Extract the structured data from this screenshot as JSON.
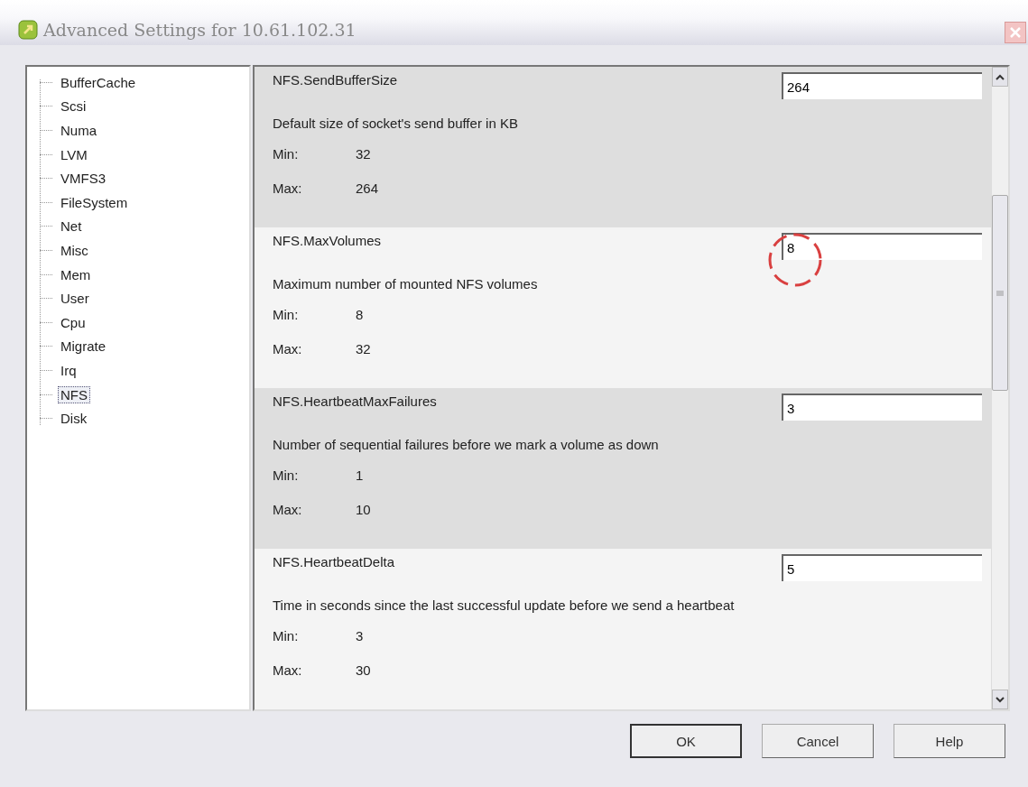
{
  "window": {
    "title": "Advanced Settings for 10.61.102.31"
  },
  "tree": {
    "items": [
      {
        "label": "BufferCache",
        "selected": false
      },
      {
        "label": "Scsi",
        "selected": false
      },
      {
        "label": "Numa",
        "selected": false
      },
      {
        "label": "LVM",
        "selected": false
      },
      {
        "label": "VMFS3",
        "selected": false
      },
      {
        "label": "FileSystem",
        "selected": false
      },
      {
        "label": "Net",
        "selected": false
      },
      {
        "label": "Misc",
        "selected": false
      },
      {
        "label": "Mem",
        "selected": false
      },
      {
        "label": "User",
        "selected": false
      },
      {
        "label": "Cpu",
        "selected": false
      },
      {
        "label": "Migrate",
        "selected": false
      },
      {
        "label": "Irq",
        "selected": false
      },
      {
        "label": "NFS",
        "selected": true
      },
      {
        "label": "Disk",
        "selected": false
      }
    ]
  },
  "settings": [
    {
      "name": "NFS.SendBufferSize",
      "value": "264",
      "description": "Default size of socket's send buffer in KB",
      "min_label": "Min:",
      "min": "32",
      "max_label": "Max:",
      "max": "264",
      "annotated": false
    },
    {
      "name": "NFS.MaxVolumes",
      "value": "8",
      "description": "Maximum number of mounted NFS volumes",
      "min_label": "Min:",
      "min": "8",
      "max_label": "Max:",
      "max": "32",
      "annotated": true
    },
    {
      "name": "NFS.HeartbeatMaxFailures",
      "value": "3",
      "description": "Number of sequential failures before we mark a volume as down",
      "min_label": "Min:",
      "min": "1",
      "max_label": "Max:",
      "max": "10",
      "annotated": false
    },
    {
      "name": "NFS.HeartbeatDelta",
      "value": "5",
      "description": "Time in seconds since the last successful update before we send a heartbeat",
      "min_label": "Min:",
      "min": "3",
      "max_label": "Max:",
      "max": "30",
      "annotated": false
    }
  ],
  "buttons": [
    "OK",
    "Cancel",
    "Help"
  ]
}
